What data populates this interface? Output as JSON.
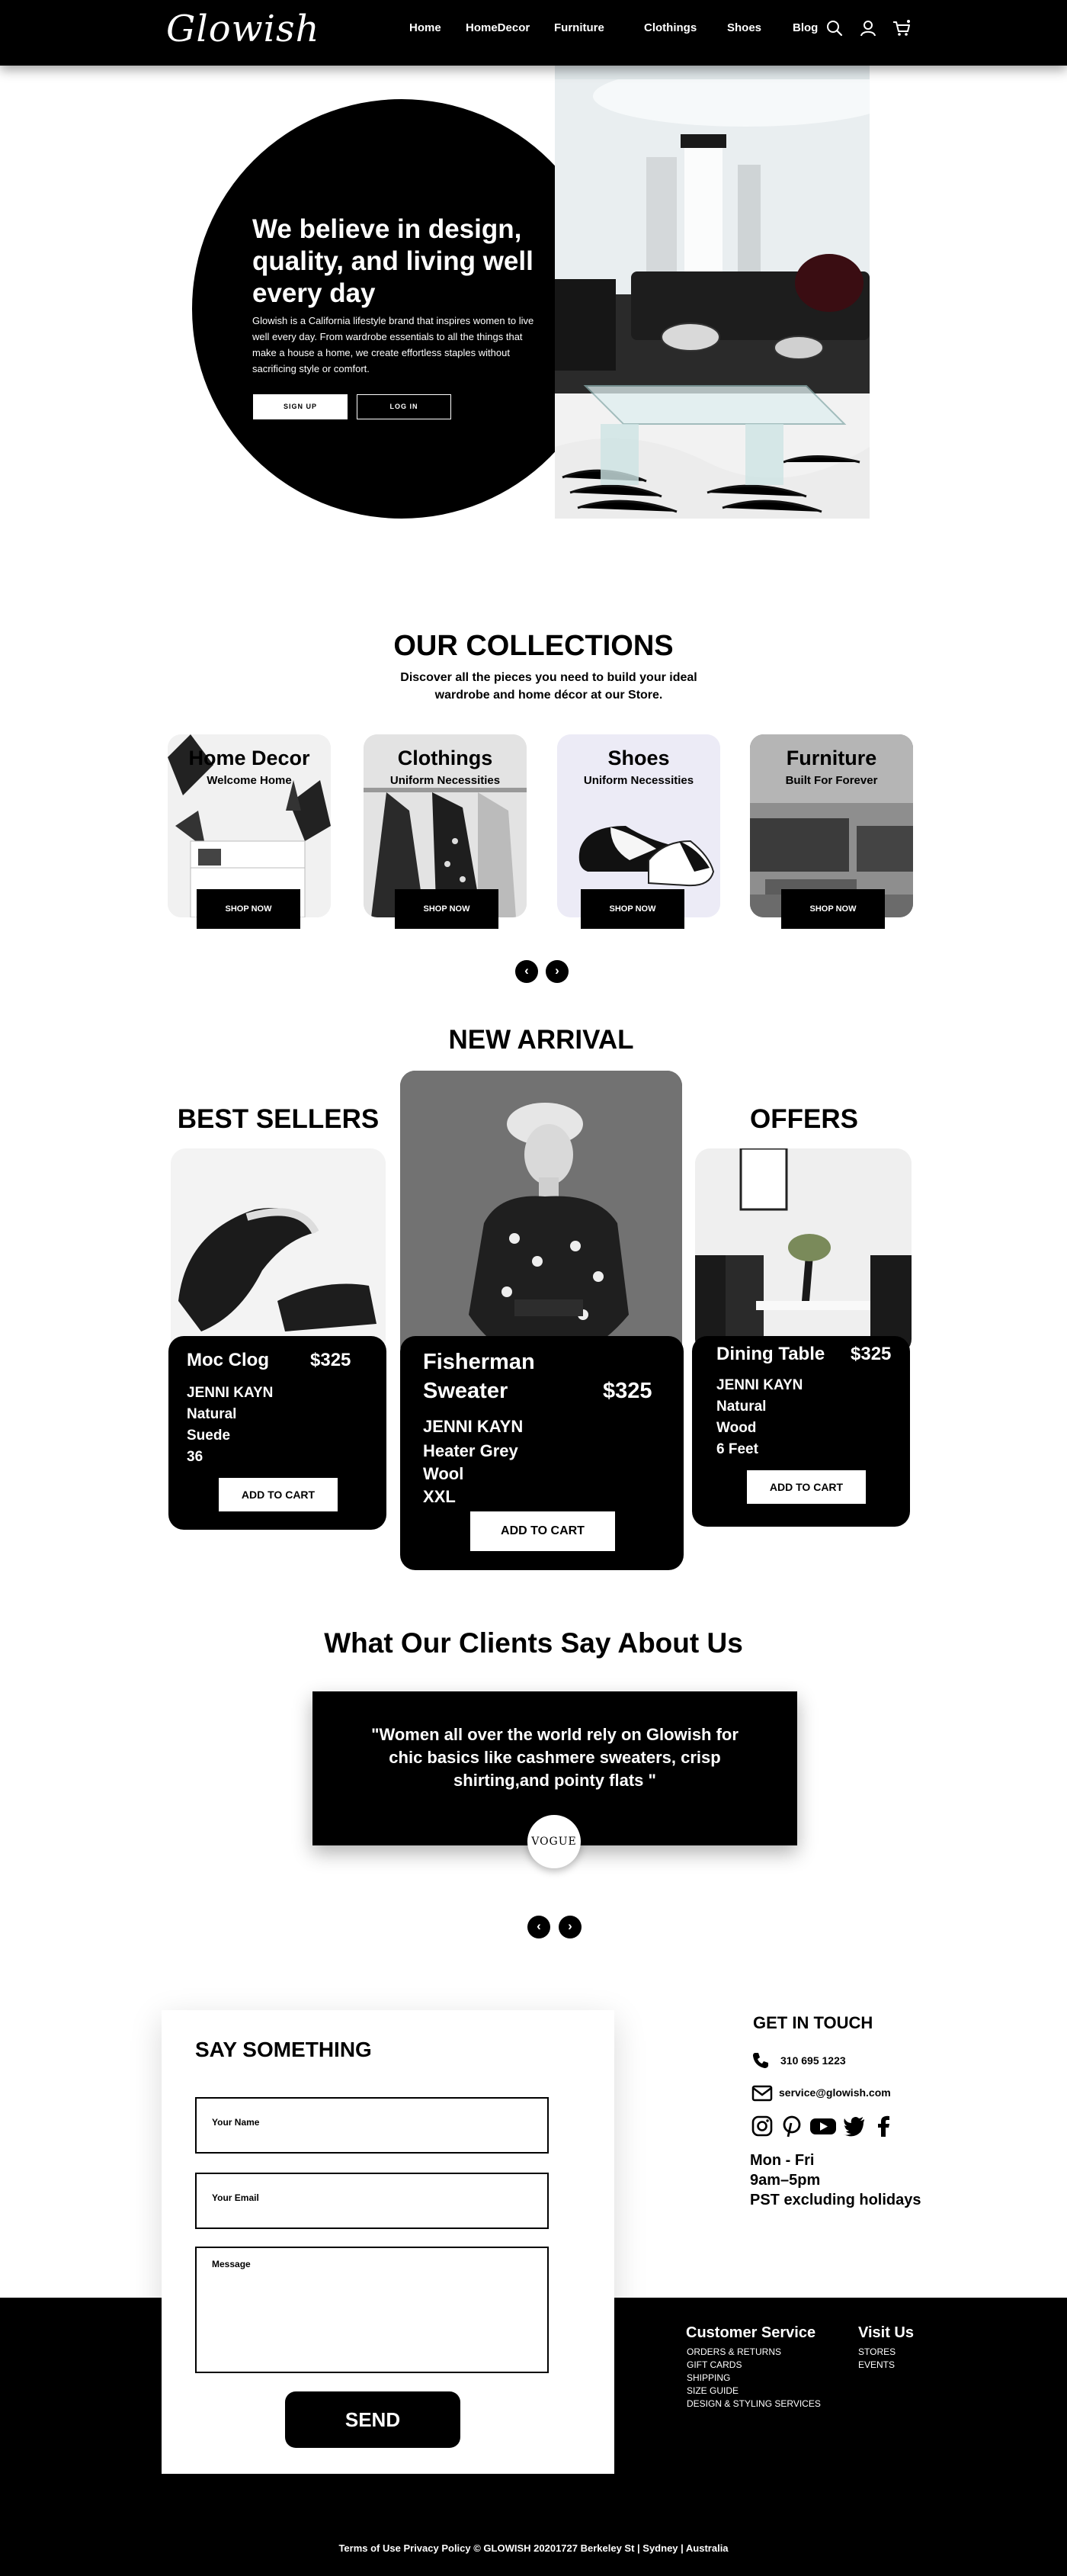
{
  "nav": {
    "logo": "Glowish",
    "links": [
      "Home",
      "HomeDecor",
      "Furniture",
      "Clothings",
      "Shoes",
      "Blog"
    ],
    "icons": [
      "search-icon",
      "user-icon",
      "cart-icon"
    ]
  },
  "hero": {
    "title": "We believe in design, quality, and living well every day",
    "text": "Glowish is a California lifestyle brand that inspires women to live well every day. From wardrobe essentials to all the things that make a house a home, we create effortless staples without sacrificing style or comfort.",
    "signup": "SIGN UP",
    "login": "LOG IN"
  },
  "collections": {
    "title": "OUR COLLECTIONS",
    "subtitle": "Discover all the pieces you  need to build your ideal wardrobe and home décor at our Store.",
    "items": [
      {
        "name": "Home Decor",
        "sub": "Welcome Home",
        "button": "SHOP NOW"
      },
      {
        "name": "Clothings",
        "sub": "Uniform Necessities",
        "button": "SHOP NOW"
      },
      {
        "name": "Shoes",
        "sub": "Uniform Necessities",
        "button": "SHOP NOW"
      },
      {
        "name": "Furniture",
        "sub": "Built For Forever",
        "button": "SHOP NOW"
      }
    ],
    "prev": "‹",
    "next": "›"
  },
  "new_arrival": {
    "title": "NEW ARRIVAL",
    "best_sellers_title": "BEST SELLERS",
    "offers_title": "OFFERS",
    "products": [
      {
        "name": "Moc  Clog",
        "price": "$325",
        "brand": "JENNI KAYN",
        "details": [
          "Natural",
          "Suede",
          "36"
        ],
        "button": "ADD TO CART"
      },
      {
        "name_line1": "Fisherman",
        "name_line2": "Sweater",
        "price": "$325",
        "brand": "JENNI KAYN",
        "details": [
          "Heater Grey",
          "Wool",
          "XXL"
        ],
        "button": "ADD TO CART"
      },
      {
        "name": "Dining Table",
        "price": "$325",
        "brand": "JENNI KAYN",
        "details": [
          "Natural",
          "Wood",
          "6 Feet"
        ],
        "button": "ADD TO CART"
      }
    ]
  },
  "testimonial": {
    "title": "What Our Clients Say About Us",
    "quote": "\"Women all over the world rely on Glowish for chic basics like cashmere sweaters, crisp shirting,and pointy flats \"",
    "source": "VOGUE",
    "prev": "‹",
    "next": "›"
  },
  "contact_form": {
    "title": "SAY SOMETHING",
    "name_placeholder": "Your Name",
    "email_placeholder": "Your Email",
    "message_placeholder": "Message",
    "send": "SEND"
  },
  "contact": {
    "title": "GET IN TOUCH",
    "phone": "310 695 1223",
    "email": "service@glowish.com",
    "socials": [
      "instagram-icon",
      "pinterest-icon",
      "youtube-icon",
      "twitter-icon",
      "facebook-icon"
    ],
    "hours_line1": "Mon - Fri",
    "hours_line2": "9am–5pm",
    "hours_line3": "PST excluding holidays"
  },
  "footer": {
    "customer_service_title": "Customer Service",
    "customer_service_links": [
      "ORDERS & RETURNS",
      "GIFT CARDS",
      "SHIPPING",
      "SIZE GUIDE",
      "DESIGN & STYLING SERVICES"
    ],
    "visit_us_title": "Visit Us",
    "visit_us_links": [
      "STORES",
      "EVENTS"
    ],
    "legal": "Terms of Use Privacy Policy © GLOWISH 20201727 Berkeley St | Sydney | Australia"
  }
}
